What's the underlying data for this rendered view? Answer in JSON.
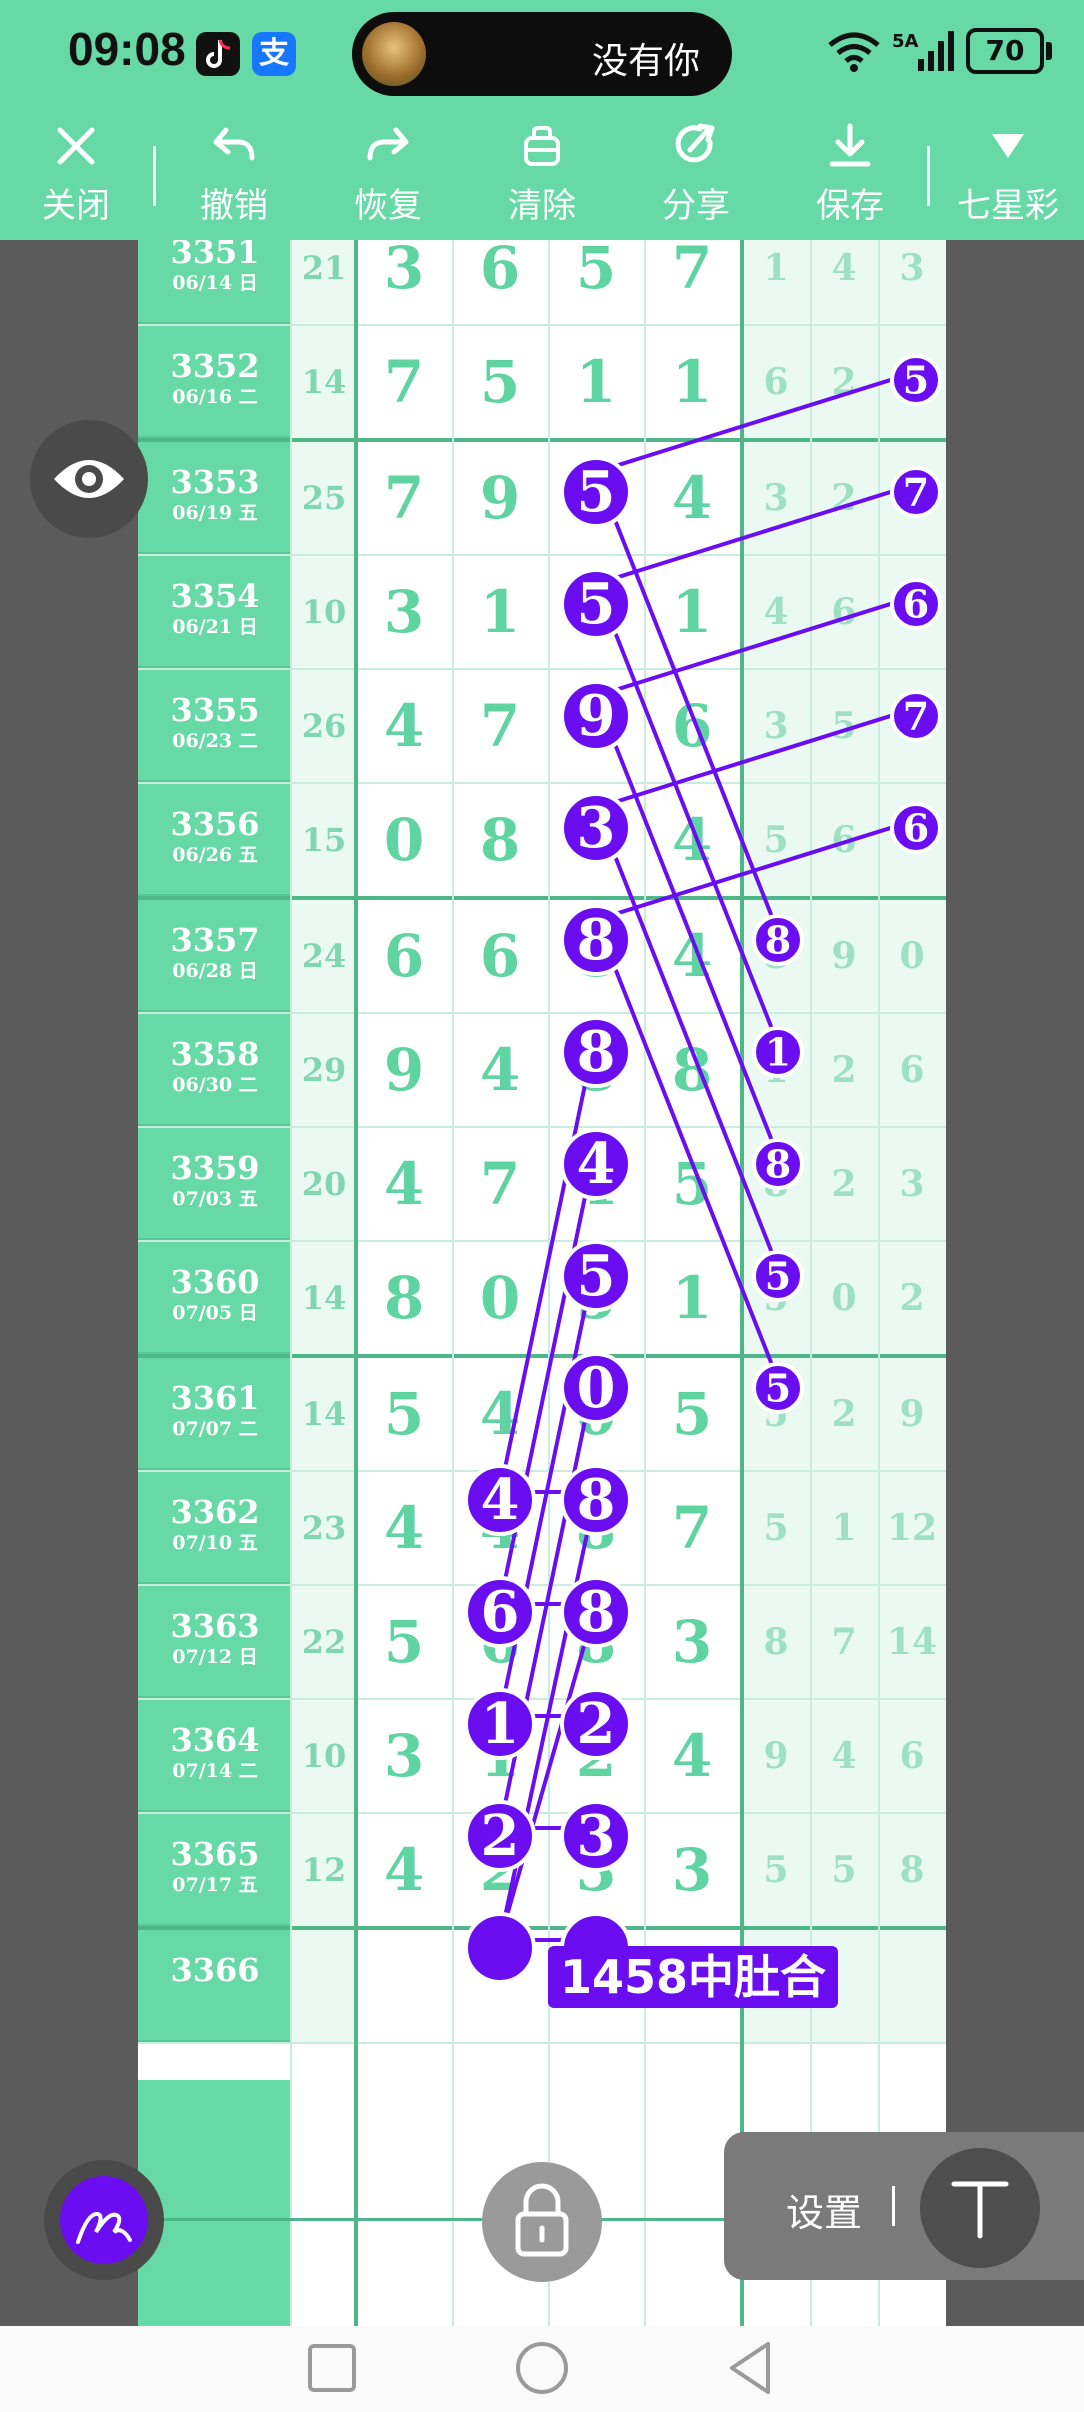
{
  "statusbar": {
    "time": "09:08",
    "alipay_glyph": "支",
    "notification_text": "没有你",
    "signal": "6ᐧ 5A",
    "battery": "70"
  },
  "toolbar": {
    "close": "关闭",
    "undo": "撤销",
    "redo": "恢复",
    "clear": "清除",
    "share": "分享",
    "save": "保存",
    "lottery": "七星彩"
  },
  "rows": [
    {
      "id": "3351",
      "date": "06/14 日",
      "sum": "21",
      "d": [
        "3",
        "6",
        "5",
        "7"
      ],
      "s": [
        "1",
        "4",
        "3"
      ]
    },
    {
      "id": "3352",
      "date": "06/16 二",
      "sum": "14",
      "d": [
        "7",
        "5",
        "1",
        "1"
      ],
      "s": [
        "6",
        "2",
        "5"
      ]
    },
    {
      "id": "3353",
      "date": "06/19 五",
      "sum": "25",
      "d": [
        "7",
        "9",
        "5",
        "4"
      ],
      "s": [
        "3",
        "2",
        "7"
      ]
    },
    {
      "id": "3354",
      "date": "06/21 日",
      "sum": "10",
      "d": [
        "3",
        "1",
        "5",
        "1"
      ],
      "s": [
        "4",
        "6",
        "6"
      ]
    },
    {
      "id": "3355",
      "date": "06/23 二",
      "sum": "26",
      "d": [
        "4",
        "7",
        "9",
        "6"
      ],
      "s": [
        "3",
        "5",
        "7"
      ]
    },
    {
      "id": "3356",
      "date": "06/26 五",
      "sum": "15",
      "d": [
        "0",
        "8",
        "3",
        "4"
      ],
      "s": [
        "5",
        "6",
        "6"
      ]
    },
    {
      "id": "3357",
      "date": "06/28 日",
      "sum": "24",
      "d": [
        "6",
        "6",
        "8",
        "4"
      ],
      "s": [
        "8",
        "9",
        "0"
      ]
    },
    {
      "id": "3358",
      "date": "06/30 二",
      "sum": "29",
      "d": [
        "9",
        "4",
        "8",
        "8"
      ],
      "s": [
        "1",
        "2",
        "6"
      ]
    },
    {
      "id": "3359",
      "date": "07/03 五",
      "sum": "20",
      "d": [
        "4",
        "7",
        "4",
        "5"
      ],
      "s": [
        "8",
        "2",
        "3"
      ]
    },
    {
      "id": "3360",
      "date": "07/05 日",
      "sum": "14",
      "d": [
        "8",
        "0",
        "5",
        "1"
      ],
      "s": [
        "5",
        "0",
        "2"
      ]
    },
    {
      "id": "3361",
      "date": "07/07 二",
      "sum": "14",
      "d": [
        "5",
        "4",
        "0",
        "5"
      ],
      "s": [
        "5",
        "2",
        "9"
      ]
    },
    {
      "id": "3362",
      "date": "07/10 五",
      "sum": "23",
      "d": [
        "4",
        "4",
        "8",
        "7"
      ],
      "s": [
        "5",
        "1",
        "12"
      ]
    },
    {
      "id": "3363",
      "date": "07/12 日",
      "sum": "22",
      "d": [
        "5",
        "6",
        "8",
        "3"
      ],
      "s": [
        "8",
        "7",
        "14"
      ]
    },
    {
      "id": "3364",
      "date": "07/14 二",
      "sum": "10",
      "d": [
        "3",
        "1",
        "2",
        "4"
      ],
      "s": [
        "9",
        "4",
        "6"
      ]
    },
    {
      "id": "3365",
      "date": "07/17 五",
      "sum": "12",
      "d": [
        "4",
        "2",
        "3",
        "3"
      ],
      "s": [
        "5",
        "5",
        "8"
      ]
    },
    {
      "id": "3366",
      "date": "",
      "sum": "",
      "d": [
        "",
        "",
        "",
        ""
      ],
      "s": [
        "",
        "",
        ""
      ]
    }
  ],
  "hint": "1458中肚合",
  "settings": {
    "label": "设置"
  },
  "icons": [
    "close-icon",
    "undo-icon",
    "redo-icon",
    "clear-icon",
    "share-icon",
    "download-icon",
    "caret-down-icon",
    "eye-icon",
    "pen-icon",
    "lock-icon",
    "text-tool-icon",
    "square-nav-icon",
    "circle-nav-icon",
    "back-nav-icon"
  ],
  "colors": {
    "accent_green": "#66d9a6",
    "digit_green": "#5fd4a2",
    "mark_purple": "#6a0df0"
  }
}
